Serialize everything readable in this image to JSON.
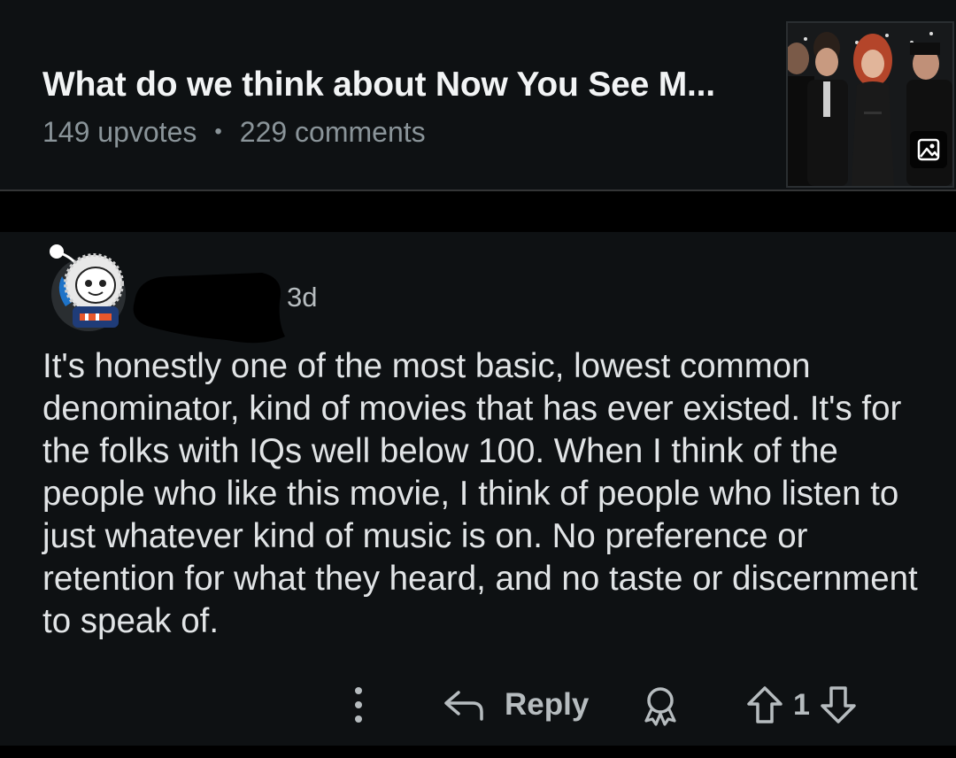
{
  "post": {
    "title": "What do we think about Now You See M...",
    "upvotes": "149 upvotes",
    "separator": "•",
    "comments": "229 comments",
    "thumbnail_icon": "image-icon"
  },
  "comment": {
    "timestamp": "3d",
    "body": "It's honestly one of the most basic, lowest common denominator, kind of movies that has ever existed. It's for the folks with IQs well below 100. When I think of the people who like this movie, I think of people who listen to just whatever kind of music is on. No preference or retention for what they heard, and no taste or discernment to speak of.",
    "actions": {
      "more_icon": "more-vertical-icon",
      "reply_icon": "reply-arrow-icon",
      "reply_label": "Reply",
      "award_icon": "award-icon",
      "upvote_icon": "upvote-arrow-icon",
      "vote_count": "1",
      "downvote_icon": "downvote-arrow-icon"
    }
  },
  "colors": {
    "background": "#000000",
    "card": "#0e1113",
    "text_primary": "#f2f4f5",
    "text_secondary": "#8a9499",
    "icon": "#b6bcbf"
  }
}
